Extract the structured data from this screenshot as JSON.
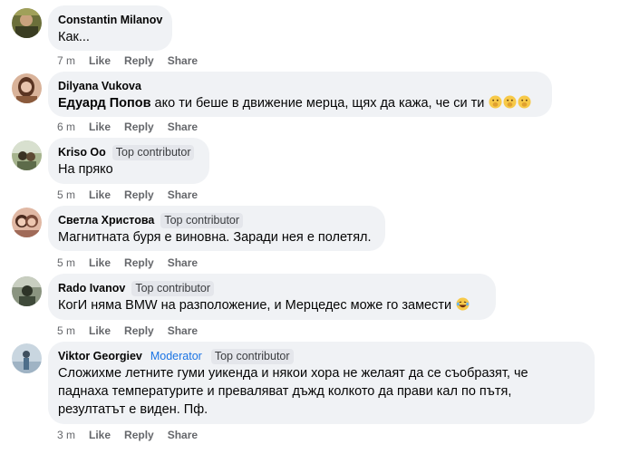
{
  "comments": [
    {
      "author": "Constantin Milanov",
      "badges": [],
      "text": "Как...",
      "time": "7 m",
      "avatar_colors": [
        "#6b6f3a",
        "#a0a05a"
      ]
    },
    {
      "author": "Dilyana Vukova",
      "badges": [],
      "mention": "Едуард Попов",
      "text": " ако ти беше в движение мерца, щях да кажа, че си ти ",
      "emoji_count": 3,
      "emoji_icon": "hand-over-mouth-emoji-icon",
      "time": "6 m",
      "avatar_colors": [
        "#8a5a3c",
        "#d9b39a"
      ]
    },
    {
      "author": "Kriso Oo",
      "badges": [
        "Top contributor"
      ],
      "text": "На пряко",
      "time": "5 m",
      "avatar_colors": [
        "#5d6b4a",
        "#a6b48e"
      ]
    },
    {
      "author": "Светла Христова",
      "badges": [
        "Top contributor"
      ],
      "text": "Магнитната буря е виновна. Заради нея е полетял.",
      "time": "5 m",
      "avatar_colors": [
        "#7a4b3a",
        "#e0b8a4"
      ]
    },
    {
      "author": "Rado Ivanov",
      "badges": [
        "Top contributor"
      ],
      "text": "КогИ няма BMW на разположение, и Мерцедес може го замести ",
      "emoji_icon": "laughing-emoji-icon",
      "time": "5 m",
      "avatar_colors": [
        "#3f4a3a",
        "#8a9480"
      ]
    },
    {
      "author": "Viktor Georgiev",
      "badges": [
        "Moderator",
        "Top contributor"
      ],
      "lines": [
        "Сложихме летните гуми уикенда и някои хора не желаят да се съобразят, че",
        "паднаха температурите и преваляват дъжд колкото да прави кал по пътя,",
        "резултатът е виден. Пф."
      ],
      "time": "3 m",
      "avatar_colors": [
        "#4d6e8a",
        "#c9d6e0"
      ]
    }
  ],
  "actions": {
    "like": "Like",
    "reply": "Reply",
    "share": "Share"
  },
  "colors": {
    "bubble": "#f0f2f5",
    "meta": "#65676b",
    "moderator": "#1b74e4",
    "badge_bg": "#e4e6eb"
  }
}
